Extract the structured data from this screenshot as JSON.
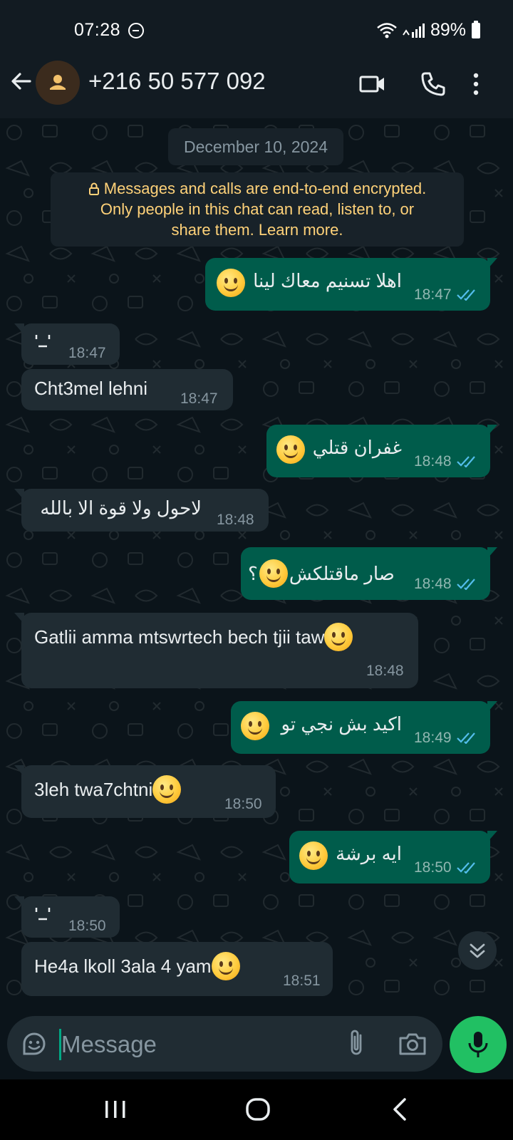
{
  "status_bar": {
    "time": "07:28",
    "battery": "89%"
  },
  "header": {
    "contact": "+216 50 577 092"
  },
  "chat": {
    "date_chip": "December 10, 2024",
    "encryption_notice": {
      "line1": "Messages and calls are end-to-end encrypted.",
      "line2": "Only people in this chat can read, listen to, or",
      "line3": "share them. Learn more."
    },
    "messages": [
      {
        "direction": "out",
        "text": "اهلا تسنيم معاك لينا",
        "emoji": "slightly-smiling-face",
        "time": "18:47",
        "status": "read"
      },
      {
        "direction": "in",
        "text": "",
        "deleted_glyph": true,
        "time": "18:47"
      },
      {
        "direction": "in",
        "text": "Cht3mel lehni",
        "time": "18:47"
      },
      {
        "direction": "out",
        "text": "غفران قتلي",
        "emoji": "slightly-smiling-face",
        "time": "18:48",
        "status": "read"
      },
      {
        "direction": "in",
        "text": "لاحول ولا قوة الا بالله",
        "time": "18:48"
      },
      {
        "direction": "out",
        "text": "صار ماقتلكش",
        "text_suffix": "؟",
        "emoji": "slightly-smiling-face",
        "time": "18:48",
        "status": "read"
      },
      {
        "direction": "in",
        "text": "Gatlii amma mtswrtech bech tjii taw",
        "emoji": "slightly-smiling-face",
        "time": "18:48"
      },
      {
        "direction": "out",
        "text": "اكيد بش نجي تو",
        "emoji": "slightly-smiling-face",
        "time": "18:49",
        "status": "read"
      },
      {
        "direction": "in",
        "text": "3leh twa7chtni",
        "emoji": "slightly-smiling-face",
        "time": "18:50"
      },
      {
        "direction": "out",
        "text": "ايه برشة",
        "emoji": "slightly-smiling-face",
        "time": "18:50",
        "status": "read"
      },
      {
        "direction": "in",
        "text": "",
        "deleted_glyph": true,
        "time": "18:50"
      },
      {
        "direction": "in",
        "text": "He4a lkoll 3ala 4 yam",
        "emoji": "slightly-smiling-face",
        "time": "18:51"
      }
    ]
  },
  "input": {
    "placeholder": "Message"
  },
  "colors": {
    "background": "#0b141a",
    "outgoing_bubble": "#005c4b",
    "incoming_bubble": "#202c33",
    "read_tick": "#53bdeb",
    "mic_button": "#21c063",
    "encryption_text": "#ffd279"
  },
  "icons": [
    "back-arrow-icon",
    "avatar-person-icon",
    "video-call-icon",
    "voice-call-icon",
    "more-options-icon",
    "lock-icon",
    "double-check-icon",
    "scroll-down-icon",
    "sticker-icon",
    "attach-icon",
    "camera-icon",
    "mic-icon",
    "recents-icon",
    "home-icon",
    "nav-back-icon"
  ]
}
